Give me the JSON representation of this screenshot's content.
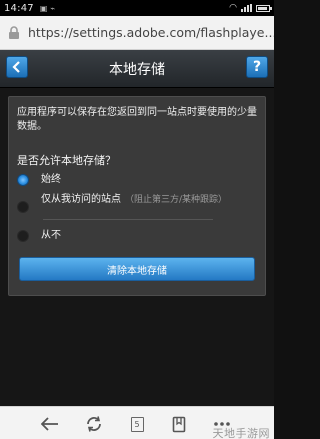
{
  "status_bar": {
    "time": "14:47"
  },
  "url_bar": {
    "url": "https://settings.adobe.com/flashplaye..."
  },
  "header": {
    "title": "本地存储",
    "back_label": "<",
    "help_label": "?"
  },
  "storage": {
    "description": "应用程序可以保存在您返回到同一站点时要使用的少量数据。",
    "question": "是否允许本地存储？",
    "options": [
      {
        "label": "始终",
        "note": "",
        "selected": true
      },
      {
        "label": "仅从我访问的站点",
        "note": "（阻止第三方/某种跟踪）",
        "selected": false
      },
      {
        "label": "从不",
        "note": "",
        "selected": false
      }
    ],
    "clear_button": "清除本地存储"
  },
  "nav": {
    "tab_count": "5"
  },
  "watermark": "天地手游网",
  "colors": {
    "accent": "#2b8ee0",
    "panel": "#3a3a3a",
    "background": "#161616"
  },
  "icons": [
    "lock-icon",
    "back-icon",
    "reload-icon",
    "tabs-icon",
    "bookmark-icon",
    "menu-icon"
  ]
}
